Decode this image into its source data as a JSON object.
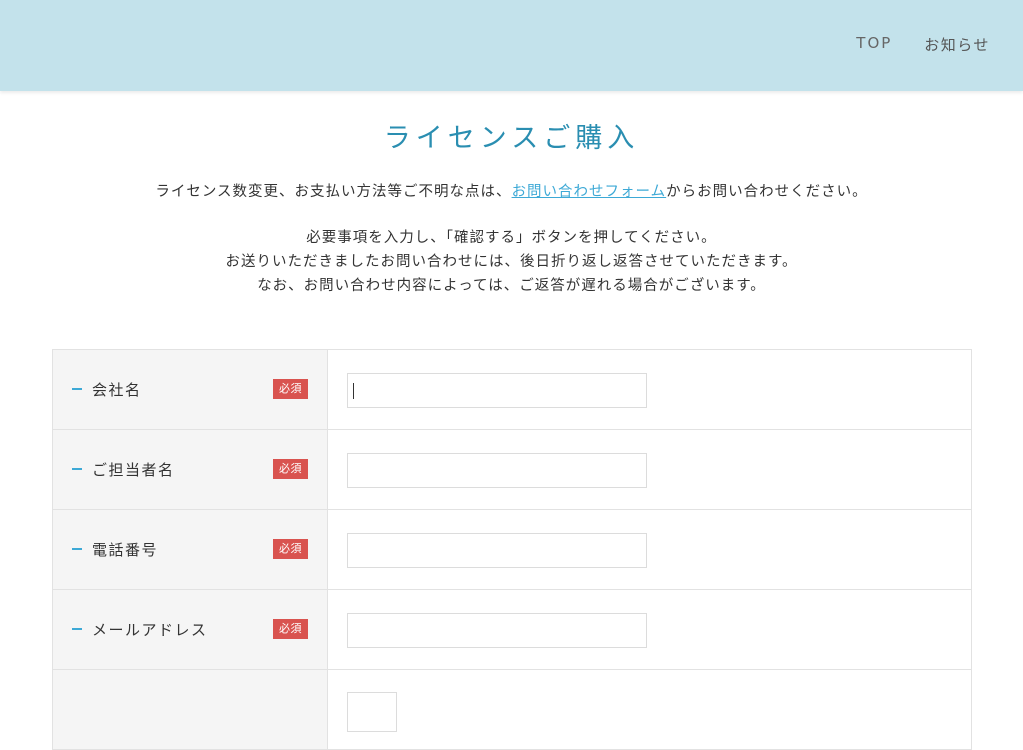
{
  "nav": {
    "top_label": "TOP",
    "news_label": "お知らせ"
  },
  "page": {
    "title": "ライセンスご購入",
    "intro_before": "ライセンス数変更、お支払い方法等ご不明な点は、",
    "intro_link": "お問い合わせフォーム",
    "intro_after": "からお問い合わせください。",
    "instructions": [
      "必要事項を入力し、「確認する」ボタンを押してください。",
      "お送りいただきましたお問い合わせには、後日折り返し返答させていただきます。",
      "なお、お問い合わせ内容によっては、ご返答が遅れる場合がございます。"
    ]
  },
  "form": {
    "rows": [
      {
        "label": "会社名",
        "required": "必須",
        "value": ""
      },
      {
        "label": "ご担当者名",
        "required": "必須",
        "value": ""
      },
      {
        "label": "電話番号",
        "required": "必須",
        "value": ""
      },
      {
        "label": "メールアドレス",
        "required": "必須",
        "value": ""
      }
    ]
  },
  "colors": {
    "header_bg": "#c3e2eb",
    "accent": "#2a8eb1",
    "link": "#3da9d6",
    "required_badge": "#d9534f"
  }
}
